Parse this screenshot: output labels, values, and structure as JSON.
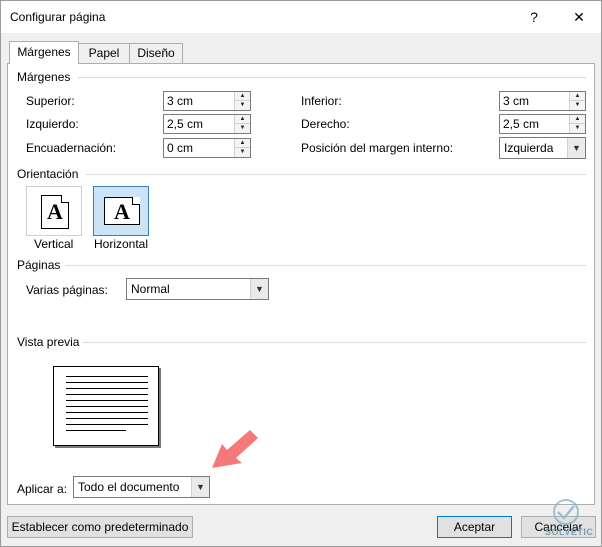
{
  "window": {
    "title": "Configurar página",
    "help_icon": "?",
    "close_icon": "✕"
  },
  "tabs": [
    {
      "label": "Márgenes",
      "active": true
    },
    {
      "label": "Papel",
      "active": false
    },
    {
      "label": "Diseño",
      "active": false
    }
  ],
  "margins": {
    "section_label": "Márgenes",
    "superior_label": "Superior:",
    "superior_value": "3 cm",
    "izquierdo_label": "Izquierdo:",
    "izquierdo_value": "2,5 cm",
    "encuadernacion_label": "Encuadernación:",
    "encuadernacion_value": "0 cm",
    "inferior_label": "Inferior:",
    "inferior_value": "3 cm",
    "derecho_label": "Derecho:",
    "derecho_value": "2,5 cm",
    "posicion_label": "Posición del margen interno:",
    "posicion_value": "Izquierda"
  },
  "orientation": {
    "section_label": "Orientación",
    "vertical_label": "Vertical",
    "horizontal_label": "Horizontal",
    "glyph": "A",
    "selected": "horizontal"
  },
  "pages": {
    "section_label": "Páginas",
    "varias_label": "Varias páginas:",
    "varias_value": "Normal"
  },
  "preview": {
    "section_label": "Vista previa"
  },
  "apply": {
    "label": "Aplicar a:",
    "value": "Todo el documento"
  },
  "buttons": {
    "default_label": "Establecer como predeterminado",
    "accept_label": "Aceptar",
    "cancel_label": "Cancelar"
  },
  "watermark": {
    "text": "SOLVETIC"
  },
  "colors": {
    "accent": "#0078d7",
    "selection": "#cce4f7",
    "pointer": "#f47a7a"
  }
}
